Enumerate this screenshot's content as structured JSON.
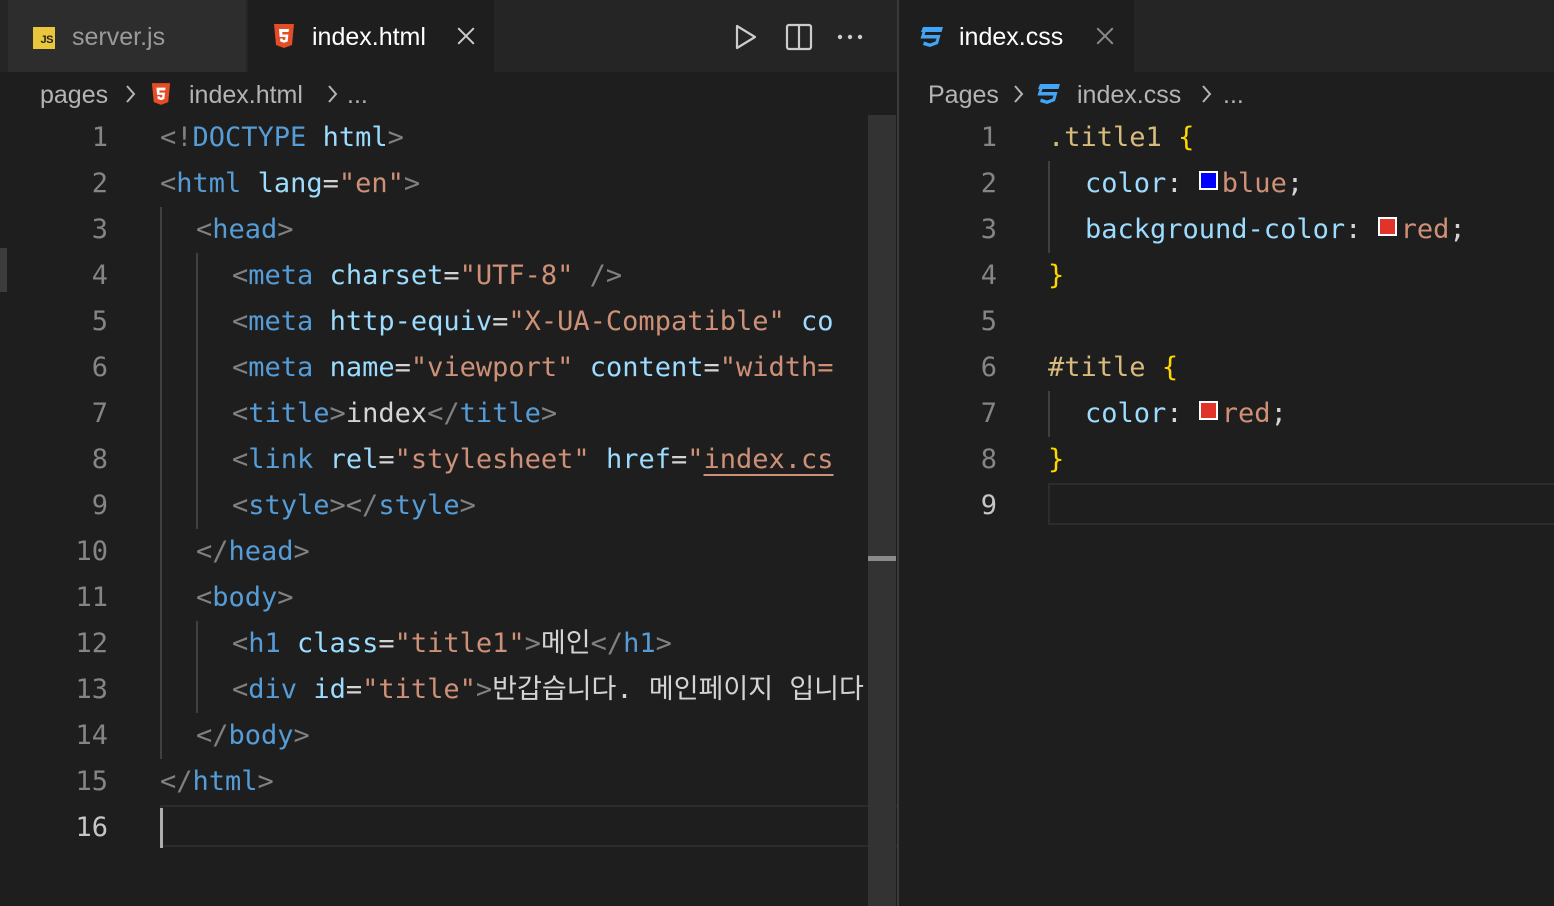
{
  "colors": {
    "editor_bg": "#1e1e1e",
    "tabbar_bg": "#252526",
    "html_icon": "#e44d26",
    "css_icon": "#42a5f5",
    "js_icon": "#e8c73d",
    "swatch_blue": "#0000ff",
    "swatch_red": "#ff0000"
  },
  "left_editor": {
    "tabs": [
      {
        "label": "server.js",
        "icon": "js-file-icon",
        "active": false
      },
      {
        "label": "index.html",
        "icon": "html5-file-icon",
        "active": true,
        "close": "close-icon"
      }
    ],
    "actions": [
      "run-icon",
      "split-editor-icon",
      "more-actions-icon"
    ],
    "breadcrumb": {
      "folder": "pages",
      "file": "index.html",
      "more": "..."
    },
    "line_numbers": [
      "1",
      "2",
      "3",
      "4",
      "5",
      "6",
      "7",
      "8",
      "9",
      "10",
      "11",
      "12",
      "13",
      "14",
      "15",
      "16"
    ],
    "current_line": "16",
    "lines": {
      "l1": {
        "p1": "<!",
        "tag": "DOCTYPE",
        "sp": " ",
        "attr": "html",
        "p2": ">"
      },
      "l2": {
        "p1": "<",
        "tag": "html",
        "sp": " ",
        "attr": "lang",
        "eq": "=",
        "str": "\"en\"",
        "p2": ">"
      },
      "l3": {
        "p1": "<",
        "tag": "head",
        "p2": ">"
      },
      "l4": {
        "p1": "<",
        "tag": "meta",
        "sp": " ",
        "attr": "charset",
        "eq": "=",
        "str": "\"UTF-8\"",
        "p2": " />"
      },
      "l5": {
        "p1": "<",
        "tag": "meta",
        "sp": " ",
        "attr": "http-equiv",
        "eq": "=",
        "str": "\"X-UA-Compatible\"",
        "sp2": " ",
        "attr2": "co"
      },
      "l6": {
        "p1": "<",
        "tag": "meta",
        "sp": " ",
        "attr": "name",
        "eq": "=",
        "str": "\"viewport\"",
        "sp2": " ",
        "attr2": "content",
        "eq2": "=",
        "str2": "\"width="
      },
      "l7": {
        "p1": "<",
        "tag": "title",
        "p2": ">",
        "text": "index",
        "p3": "</",
        "tag2": "title",
        "p4": ">"
      },
      "l8": {
        "p1": "<",
        "tag": "link",
        "sp": " ",
        "attr": "rel",
        "eq": "=",
        "str": "\"stylesheet\"",
        "sp2": " ",
        "attr2": "href",
        "eq2": "=",
        "q": "\"",
        "link": "index.cs"
      },
      "l9": {
        "p1": "<",
        "tag": "style",
        "p2": "></",
        "tag2": "style",
        "p3": ">"
      },
      "l10": {
        "p1": "</",
        "tag": "head",
        "p2": ">"
      },
      "l11": {
        "p1": "<",
        "tag": "body",
        "p2": ">"
      },
      "l12": {
        "p1": "<",
        "tag": "h1",
        "sp": " ",
        "attr": "class",
        "eq": "=",
        "str": "\"title1\"",
        "p2": ">",
        "text": "메인",
        "p3": "</",
        "tag2": "h1",
        "p4": ">"
      },
      "l13": {
        "p1": "<",
        "tag": "div",
        "sp": " ",
        "attr": "id",
        "eq": "=",
        "str": "\"title\"",
        "p2": ">",
        "text": "반갑습니다. 메인페이지 입니다"
      },
      "l14": {
        "p1": "</",
        "tag": "body",
        "p2": ">"
      },
      "l15": {
        "p1": "</",
        "tag": "html",
        "p2": ">"
      }
    }
  },
  "right_editor": {
    "tabs": [
      {
        "label": "index.css",
        "icon": "css3-file-icon",
        "active": true,
        "close": "close-icon"
      }
    ],
    "breadcrumb": {
      "folder": "Pages",
      "file": "index.css",
      "more": "..."
    },
    "line_numbers": [
      "1",
      "2",
      "3",
      "4",
      "5",
      "6",
      "7",
      "8",
      "9"
    ],
    "current_line": "9",
    "lines": {
      "l1": {
        "sel": ".title1",
        "sp": " ",
        "brace": "{"
      },
      "l2": {
        "prop": "color",
        "colon": ": ",
        "value": "blue",
        "semi": ";"
      },
      "l3": {
        "prop": "background-color",
        "colon": ": ",
        "value": "red",
        "semi": ";"
      },
      "l4": {
        "brace": "}"
      },
      "l6": {
        "sel": "#title",
        "sp": " ",
        "brace": "{"
      },
      "l7": {
        "prop": "color",
        "colon": ": ",
        "value": "red",
        "semi": ";"
      },
      "l8": {
        "brace": "}"
      }
    }
  }
}
